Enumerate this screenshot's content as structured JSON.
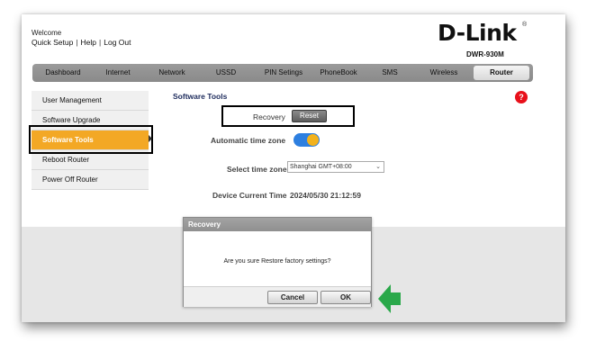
{
  "header": {
    "welcome": "Welcome",
    "links": [
      "Quick Setup",
      "Help",
      "Log Out"
    ],
    "separator": "|",
    "brand": "D-Link",
    "brand_mark": "®",
    "model": "DWR-930M"
  },
  "nav": {
    "items": [
      "Dashboard",
      "Internet",
      "Network",
      "USSD",
      "PIN Setings",
      "PhoneBook",
      "SMS",
      "Wireless",
      "Router"
    ],
    "active": "Router"
  },
  "sidebar": {
    "items": [
      "User Management",
      "Software Upgrade",
      "Software Tools",
      "Reboot Router",
      "Power Off Router"
    ],
    "active": "Software Tools"
  },
  "main": {
    "title": "Software Tools",
    "help_icon": "?",
    "recovery_label": "Recovery",
    "reset_label": "Reset",
    "auto_tz_label": "Automatic time zone",
    "auto_tz_enabled": true,
    "select_tz_label": "Select time zone",
    "tz_value": "Shanghai   GMT+08:00",
    "tz_chevron": "⌄",
    "device_time_label": "Device Current Time",
    "device_time_value": "2024/05/30 21:12:59"
  },
  "dialog": {
    "title": "Recovery",
    "message": "Are you sure Restore factory settings?",
    "cancel_label": "Cancel",
    "ok_label": "OK"
  },
  "colors": {
    "accent_orange": "#f3a825",
    "toggle_blue": "#2d7fe0",
    "help_red": "#e8101a",
    "arrow_green": "#2aa84a"
  },
  "icons": [
    "help-icon",
    "chevron-down-icon",
    "green-arrow-icon",
    "menu-pointer-icon"
  ]
}
